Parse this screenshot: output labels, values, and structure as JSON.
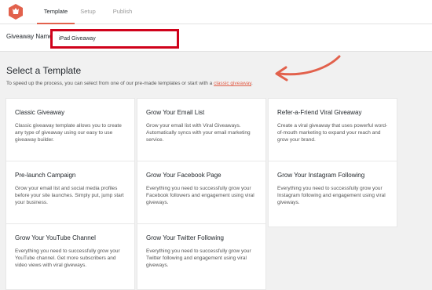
{
  "tabs": [
    "Template",
    "Setup",
    "Publish"
  ],
  "active_tab": "Template",
  "giveaway_name": {
    "label": "Giveaway Name",
    "value": "iPad Giveaway"
  },
  "section": {
    "title": "Select a Template",
    "description_prefix": "To speed up the process, you can select from one of our pre-made templates or start with a ",
    "description_link": "classic giveaway",
    "description_suffix": "."
  },
  "templates": [
    {
      "title": "Classic Giveaway",
      "desc": "Classic giveaway template allows you to create any type of giveaway using our easy to use giveaway builder."
    },
    {
      "title": "Grow Your Email List",
      "desc": "Grow your email list with Viral Giveaways. Automatically syncs with your email marketing service."
    },
    {
      "title": "Refer-a-Friend Viral Giveaway",
      "desc": "Create a viral giveaway that uses powerful word-of-mouth marketing to expand your reach and grow your brand."
    },
    {
      "title": "Pre-launch Campaign",
      "desc": "Grow your email list and social media profiles before your site launches. Simply put, jump start your business."
    },
    {
      "title": "Grow Your Facebook Page",
      "desc": "Everything you need to successfully grow your Facebook followers and engagement using viral giveways."
    },
    {
      "title": "Grow Your Instagram Following",
      "desc": "Everything you need to successfully grow your Instagram following and engagement using viral giveways."
    },
    {
      "title": "Grow Your YouTube Channel",
      "desc": "Everything you need to successfully grow your YouTube channel. Get more subscribers and video views with viral giveways."
    },
    {
      "title": "Grow Your Twitter Following",
      "desc": "Everything you need to successfully grow your Twitter following and engagement using viral giveways."
    }
  ],
  "colors": {
    "accent": "#e2614c",
    "highlight_border": "#d0021b",
    "background": "#f1f1f1"
  }
}
